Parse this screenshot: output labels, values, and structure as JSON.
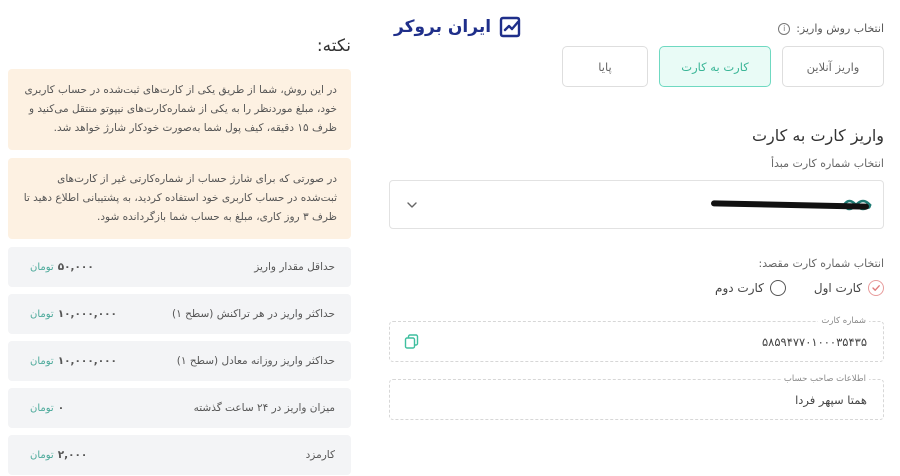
{
  "brand": {
    "name": "ایران بروکر",
    "color": "#1f2f8a"
  },
  "payment": {
    "method_label": "انتخاب روش واریز:",
    "tabs": [
      {
        "label": "واریز آنلاین",
        "active": false
      },
      {
        "label": "کارت به کارت",
        "active": true
      },
      {
        "label": "پایا",
        "active": false
      }
    ],
    "section_title": "واریز کارت به کارت",
    "source_label": "انتخاب شماره کارت مبدأ",
    "destination_label": "انتخاب شماره کارت مقصد:",
    "destination_options": [
      {
        "label": "کارت اول",
        "checked": true
      },
      {
        "label": "کارت دوم",
        "checked": false
      }
    ],
    "card_number_legend": "شماره کارت",
    "card_number_value": "۵۸۵۹۴۷۷۰۱۰۰۰۳۵۴۳۵",
    "owner_legend": "اطلاعات صاحب حساب",
    "owner_value": "همتا سپهر فردا"
  },
  "notes": {
    "title": "نکته:",
    "items": [
      "در این روش، شما از طریق یکی از کارت‌های ثبت‌شده در حساب کاربری خود، مبلغ موردنظر را به یکی از شماره‌کارت‌های نیپوتو منتقل می‌کنید و ظرف ۱۵ دقیقه، کیف پول شما به‌صورت خودکار شارژ خواهد شد.",
      "در صورتی که برای شارژ حساب از شماره‌کارتی غیر از کارت‌های ثبت‌شده در حساب کاربری خود استفاده کردید، به پشتیبانی اطلاع دهید تا ظرف ۳ روز کاری، مبلغ به حساب شما بازگردانده شود."
    ]
  },
  "limits": [
    {
      "label": "حداقل مقدار واریز",
      "value": "۵۰,۰۰۰",
      "unit": "تومان"
    },
    {
      "label": "حداکثر واریز در هر تراکنش (سطح ۱)",
      "value": "۱۰,۰۰۰,۰۰۰",
      "unit": "تومان"
    },
    {
      "label": "حداکثر واریز روزانه معادل (سطح ۱)",
      "value": "۱۰,۰۰۰,۰۰۰",
      "unit": "تومان"
    },
    {
      "label": "میزان واریز در ۲۴ ساعت گذشته",
      "value": "۰",
      "unit": "تومان"
    },
    {
      "label": "کارمزد",
      "value": "۲,۰۰۰",
      "unit": "تومان"
    }
  ],
  "colors": {
    "accent": "#39b596",
    "accent_bg": "#e9fbf6",
    "note_bg": "#fdf1e2",
    "limit_bg": "#f3f4f6"
  }
}
